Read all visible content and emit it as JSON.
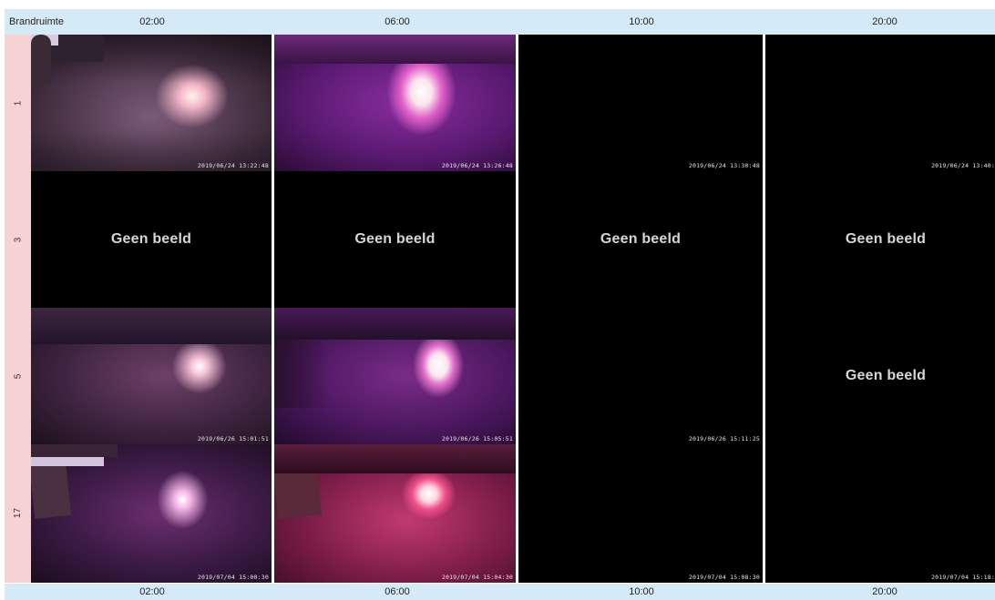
{
  "corner_label": "Brandruimte",
  "times": [
    "02:00",
    "06:00",
    "10:00",
    "20:00"
  ],
  "rows": [
    "1",
    "3",
    "5",
    "17"
  ],
  "no_image_text": "Geen beeld",
  "stamps": {
    "r1c1": "2019/06/24 13:22:48",
    "r1c2": "2019/06/24 13:26:48",
    "r1c3": "2019/06/24 13:30:48",
    "r1c4": "2019/06/24 13:40:",
    "r3c1": "2019/06/26 15:01:51",
    "r3c2": "2019/06/26 15:05:51",
    "r3c3": "2019/06/26 15:11:25",
    "r4c1": "2019/07/04 15:00:30",
    "r4c2": "2019/07/04 15:04:30",
    "r4c3": "2019/07/04 15:08:30",
    "r4c4": "2019/07/04 15:18:"
  }
}
